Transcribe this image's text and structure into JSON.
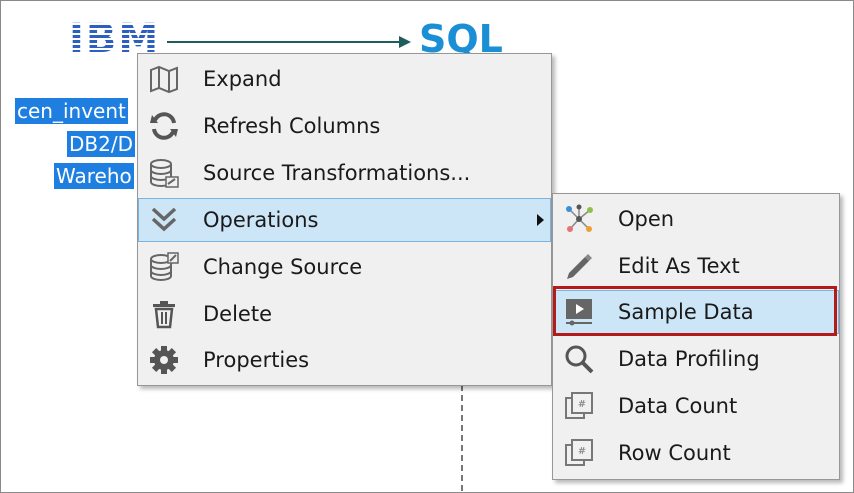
{
  "canvas": {
    "logo_text": "IBM",
    "target_text": "SQL",
    "node_lines": [
      "cen_invent",
      "DB2/D",
      "Wareho"
    ]
  },
  "context_menu": {
    "items": [
      {
        "label": "Expand",
        "icon": "map-icon"
      },
      {
        "label": "Refresh Columns",
        "icon": "refresh-icon"
      },
      {
        "label": "Source Transformations...",
        "icon": "database-edit-icon"
      },
      {
        "label": "Operations",
        "icon": "double-chevron-down-icon",
        "has_submenu": true,
        "active": true
      },
      {
        "label": "Change Source",
        "icon": "database-change-icon"
      },
      {
        "label": "Delete",
        "icon": "trash-icon"
      },
      {
        "label": "Properties",
        "icon": "gear-icon"
      }
    ]
  },
  "operations_submenu": {
    "items": [
      {
        "label": "Open",
        "icon": "network-icon"
      },
      {
        "label": "Edit As Text",
        "icon": "pencil-icon"
      },
      {
        "label": "Sample Data",
        "icon": "play-data-icon",
        "active": true
      },
      {
        "label": "Data Profiling",
        "icon": "magnifier-icon"
      },
      {
        "label": "Data Count",
        "icon": "count-icon"
      },
      {
        "label": "Row Count",
        "icon": "count-icon"
      }
    ]
  },
  "colors": {
    "selection_blue": "#1f7fe0",
    "menu_hover": "#cde6f7",
    "highlight_red": "#b31b1b",
    "sql_blue": "#1b8fd6",
    "ibm_blue": "#2d5fc3"
  }
}
